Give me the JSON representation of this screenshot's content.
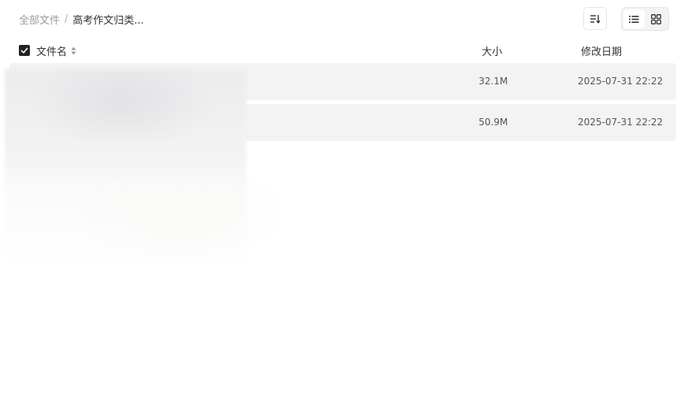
{
  "breadcrumb": {
    "root": "全部文件",
    "separator": "/",
    "current": "高考作文归类..."
  },
  "toolbar": {
    "sort_icon": "sort-list-icon",
    "list_view_icon": "list-view-icon",
    "grid_view_icon": "grid-view-icon",
    "active_view": "list"
  },
  "table": {
    "select_all_checked": true,
    "columns": {
      "name": "文件名",
      "size": "大小",
      "date": "修改日期"
    },
    "rows": [
      {
        "name": "",
        "size": "32.1M",
        "date": "2025-07-31 22:22"
      },
      {
        "name": "",
        "size": "50.9M",
        "date": "2025-07-31 22:22"
      }
    ]
  }
}
